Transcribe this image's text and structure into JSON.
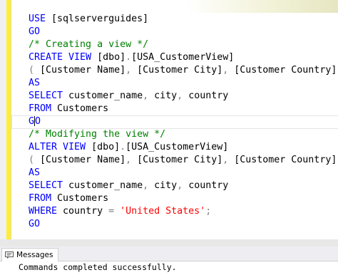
{
  "editor": {
    "lines": [
      [
        {
          "t": "USE ",
          "c": "kw"
        },
        {
          "t": "[sqlserverguides]",
          "c": ""
        }
      ],
      [
        {
          "t": "GO",
          "c": "kw"
        }
      ],
      [
        {
          "t": "/* Creating a view */",
          "c": "cm"
        }
      ],
      [
        {
          "t": "CREATE VIEW ",
          "c": "kw"
        },
        {
          "t": "[dbo]",
          "c": ""
        },
        {
          "t": ".",
          "c": "gr"
        },
        {
          "t": "[USA_CustomerView]",
          "c": ""
        }
      ],
      [
        {
          "t": "( ",
          "c": "gr"
        },
        {
          "t": "[Customer Name]",
          "c": ""
        },
        {
          "t": ", ",
          "c": "gr"
        },
        {
          "t": "[Customer City]",
          "c": ""
        },
        {
          "t": ", ",
          "c": "gr"
        },
        {
          "t": "[Customer Country]",
          "c": ""
        },
        {
          "t": " )",
          "c": "gr"
        }
      ],
      [
        {
          "t": "AS",
          "c": "kw"
        }
      ],
      [
        {
          "t": "SELECT ",
          "c": "kw"
        },
        {
          "t": "customer_name",
          "c": ""
        },
        {
          "t": ", ",
          "c": "gr"
        },
        {
          "t": "city",
          "c": ""
        },
        {
          "t": ", ",
          "c": "gr"
        },
        {
          "t": "country",
          "c": ""
        }
      ],
      [
        {
          "t": "FROM ",
          "c": "kw"
        },
        {
          "t": "Customers",
          "c": ""
        }
      ],
      [
        {
          "t": "GO",
          "c": "kw"
        }
      ],
      [
        {
          "t": "/* Modifying the view */",
          "c": "cm"
        }
      ],
      [
        {
          "t": "ALTER VIEW ",
          "c": "kw"
        },
        {
          "t": "[dbo]",
          "c": ""
        },
        {
          "t": ".",
          "c": "gr"
        },
        {
          "t": "[USA_CustomerView]",
          "c": ""
        }
      ],
      [
        {
          "t": "( ",
          "c": "gr"
        },
        {
          "t": "[Customer Name]",
          "c": ""
        },
        {
          "t": ", ",
          "c": "gr"
        },
        {
          "t": "[Customer City]",
          "c": ""
        },
        {
          "t": ", ",
          "c": "gr"
        },
        {
          "t": "[Customer Country]",
          "c": ""
        },
        {
          "t": " )",
          "c": "gr"
        }
      ],
      [
        {
          "t": "AS",
          "c": "kw"
        }
      ],
      [
        {
          "t": "SELECT ",
          "c": "kw"
        },
        {
          "t": "customer_name",
          "c": ""
        },
        {
          "t": ", ",
          "c": "gr"
        },
        {
          "t": "city",
          "c": ""
        },
        {
          "t": ", ",
          "c": "gr"
        },
        {
          "t": "country",
          "c": ""
        }
      ],
      [
        {
          "t": "FROM ",
          "c": "kw"
        },
        {
          "t": "Customers",
          "c": ""
        }
      ],
      [
        {
          "t": "WHERE ",
          "c": "kw"
        },
        {
          "t": "country ",
          "c": ""
        },
        {
          "t": "= ",
          "c": "gr"
        },
        {
          "t": "'United States'",
          "c": "st"
        },
        {
          "t": ";",
          "c": "gr"
        }
      ],
      [
        {
          "t": "GO",
          "c": "kw"
        }
      ]
    ],
    "current_line": 8
  },
  "results_panel": {
    "tab_label": "Messages",
    "message": "Commands completed successfully."
  },
  "colors": {
    "keyword": "#0000ff",
    "comment": "#008000",
    "string": "#ff0000",
    "operator": "#808080",
    "change_bar": "#ffee33"
  }
}
